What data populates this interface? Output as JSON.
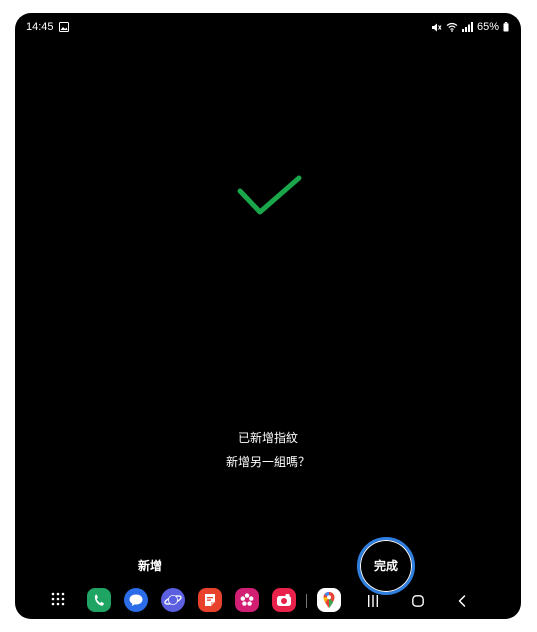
{
  "status_bar": {
    "time": "14:45",
    "battery": "65%",
    "icons": [
      "image-icon",
      "mute-icon",
      "wifi-icon",
      "signal-icon",
      "battery-icon"
    ]
  },
  "main": {
    "success_icon": "checkmark-icon",
    "success_color": "#1aa64a",
    "line1": "已新增指紋",
    "line2": "新增另一組嗎？"
  },
  "actions": {
    "add_label": "新增",
    "done_label": "完成",
    "focus_ring_color": "#2f7fe0"
  },
  "taskbar": {
    "apps": [
      "apps-grid-icon",
      "phone-app-icon",
      "messages-app-icon",
      "internet-app-icon",
      "notes-app-icon",
      "gallery-app-icon",
      "camera-app-icon",
      "maps-app-icon"
    ],
    "nav": [
      "recents-button",
      "home-button",
      "back-button"
    ]
  }
}
